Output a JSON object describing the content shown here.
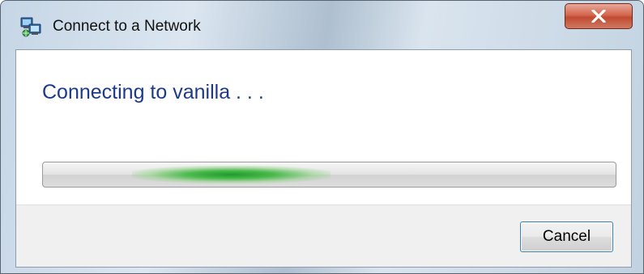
{
  "window": {
    "title": "Connect to a Network",
    "title_icon": "network-icon",
    "close_icon": "close-icon"
  },
  "main": {
    "status_text": "Connecting to vanilla . . .",
    "progress": {
      "mode": "indeterminate",
      "color": "#3cb043"
    }
  },
  "footer": {
    "cancel_label": "Cancel"
  },
  "colors": {
    "heading": "#1d3a8a",
    "close_button": "#c8503a",
    "accent_border": "#3c7fb1"
  }
}
